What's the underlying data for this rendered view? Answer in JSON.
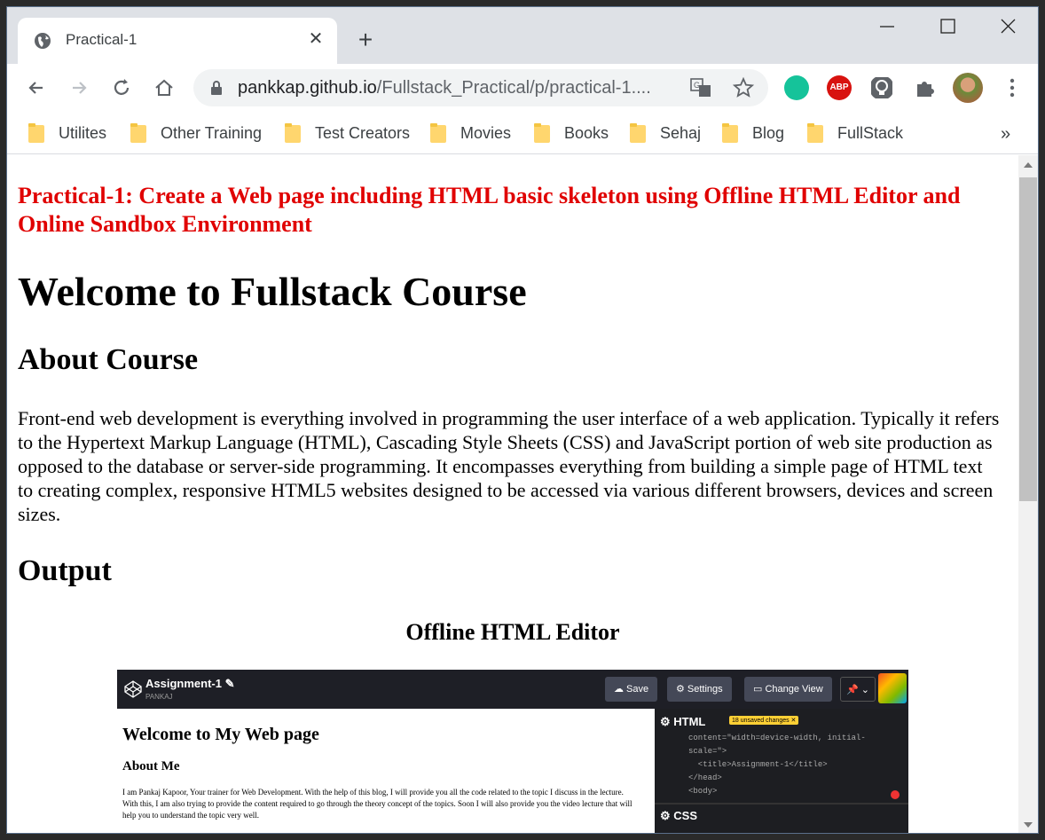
{
  "browser": {
    "tab_title": "Practical-1",
    "url_host": "pankkap.github.io",
    "url_path": "/Fullstack_Practical/p/practical-1....",
    "bookmarks": [
      "Utilites",
      "Other Training",
      "Test Creators",
      "Movies",
      "Books",
      "Sehaj",
      "Blog",
      "FullStack"
    ],
    "bookmarks_overflow": "»",
    "new_tab": "+",
    "close_tab": "✕"
  },
  "page": {
    "practical_title": "Practical-1: Create a Web page including HTML basic skeleton using Offline HTML Editor and Online Sandbox Environment",
    "heading": "Welcome to Fullstack Course",
    "about_heading": "About Course",
    "paragraph": "Front-end web development is everything involved in programming the user interface of a web application. Typically it refers to the Hypertext Markup Language (HTML), Cascading Style Sheets (CSS) and JavaScript portion of web site production as opposed to the database or server-side programming. It encompasses everything from building a simple page of HTML text to creating complex, responsive HTML5 websites designed to be accessed via various different browsers, devices and screen sizes.",
    "output_heading": "Output",
    "subheading": "Offline HTML Editor"
  },
  "screenshot": {
    "project_title": "Assignment-1 ✎",
    "project_user": "PANKAJ",
    "save": "☁ Save",
    "settings": "⚙ Settings",
    "change_view": "▭ Change View",
    "pin": "📌 ⌄",
    "preview_h1": "Welcome to My Web page",
    "preview_h2": "About Me",
    "preview_para": "I am Pankaj Kapoor, Your trainer for Web Development. With the help of this blog, I will provide you all the code related to the topic I discuss in the lecture. With this, I am also trying to provide the content required to go through the theory concept of the topics. Soon I will also provide you the video lecture that will help you to understand the topic very well.",
    "html_label": "⚙ HTML",
    "unsaved_badge": "18 unsaved changes ✕",
    "code_lines": "content=\"width=device-width, initial-\nscale=\">\n  <title>Assignment-1</title>\n</head>\n<body>",
    "css_label": "⚙ CSS"
  }
}
